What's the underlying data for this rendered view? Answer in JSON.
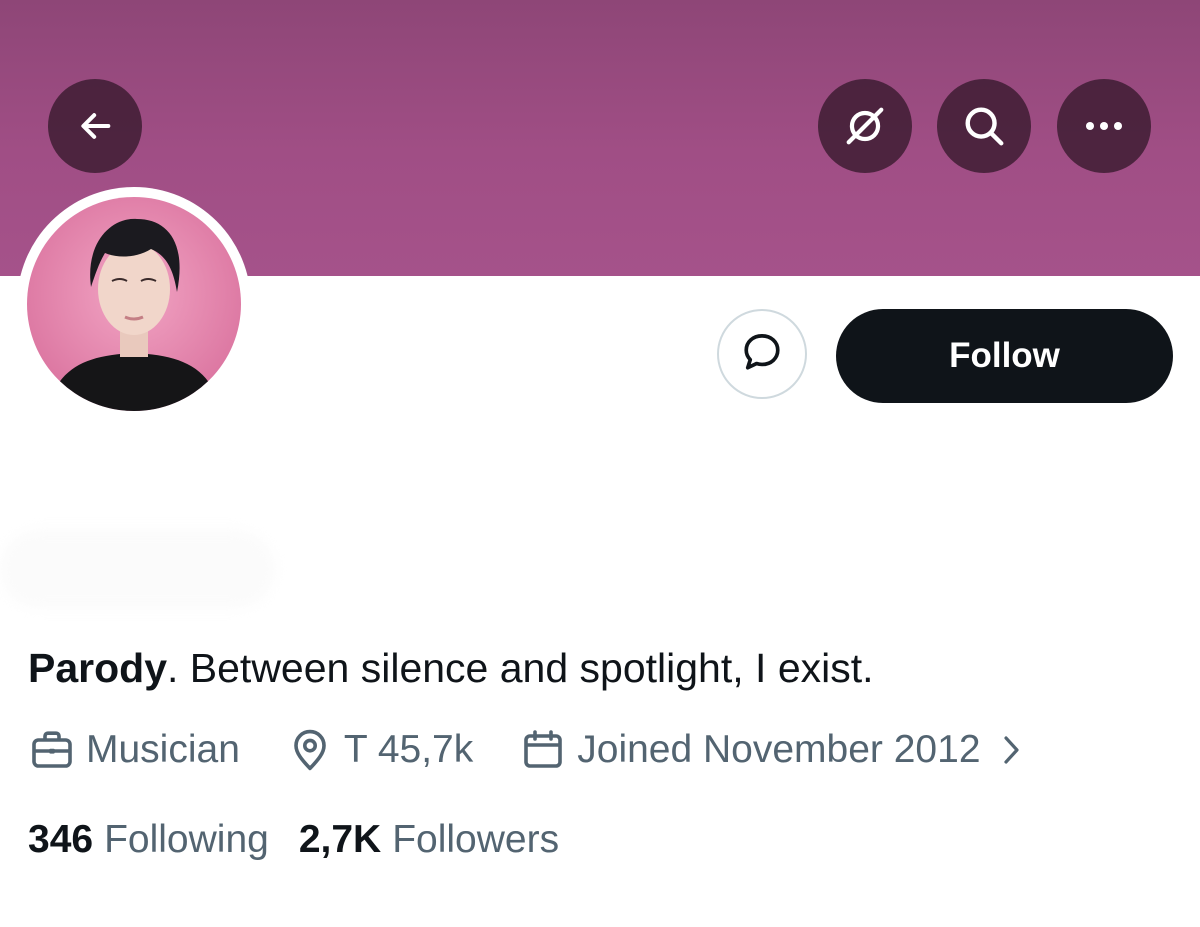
{
  "banner": {
    "color": "#a04e85"
  },
  "header": {
    "back_icon": "arrow-left-icon",
    "grok_icon": "grok-icon",
    "search_icon": "search-icon",
    "more_icon": "more-horizontal-icon"
  },
  "actions": {
    "message_icon": "message-bubble-icon",
    "follow_label": "Follow"
  },
  "profile": {
    "bio_prefix": "Parody",
    "bio_rest": ". Between silence and spotlight, I exist.",
    "profession": "Musician",
    "location": "T 45,7k",
    "joined": "Joined November 2012"
  },
  "stats": {
    "following_count": "346",
    "following_label": "Following",
    "followers_count": "2,7K",
    "followers_label": "Followers"
  }
}
